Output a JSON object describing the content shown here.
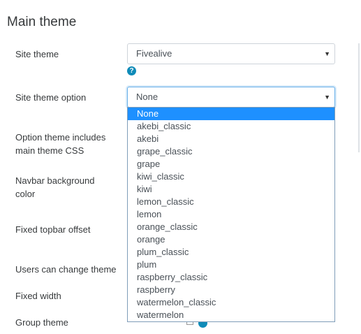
{
  "section": {
    "title": "Main theme"
  },
  "settings": {
    "site_theme": {
      "label": "Site theme",
      "value": "Fivealive"
    },
    "site_theme_option": {
      "label": "Site theme option",
      "value": "None"
    },
    "option_theme_css": {
      "label_line1": "Option theme includes",
      "label_line2": "main theme CSS"
    },
    "navbar_bg": {
      "label_line1": "Navbar background",
      "label_line2": "color"
    },
    "fixed_topbar": {
      "label": "Fixed topbar offset"
    },
    "users_change_theme": {
      "label": "Users can change theme"
    },
    "fixed_width": {
      "label": "Fixed width"
    },
    "group_theme": {
      "label": "Group theme"
    }
  },
  "icons": {
    "help": "?",
    "caret": "▼"
  },
  "dropdown": {
    "selected": "None",
    "options": [
      "None",
      "akebi_classic",
      "akebi",
      "grape_classic",
      "grape",
      "kiwi_classic",
      "kiwi",
      "lemon_classic",
      "lemon",
      "orange_classic",
      "orange",
      "plum_classic",
      "plum",
      "raspberry_classic",
      "raspberry",
      "watermelon_classic",
      "watermelon"
    ]
  },
  "colors": {
    "help_icon": "#0f8bb8",
    "highlight": "#1e90ff"
  }
}
